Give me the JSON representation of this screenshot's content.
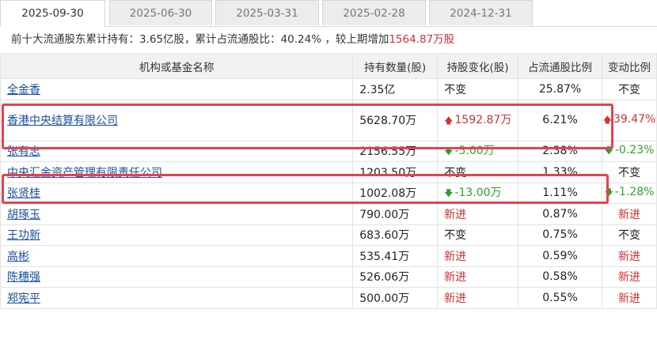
{
  "tabs": [
    {
      "label": "2025-09-30",
      "active": true
    },
    {
      "label": "2025-06-30",
      "active": false
    },
    {
      "label": "2025-03-31",
      "active": false
    },
    {
      "label": "2025-02-28",
      "active": false
    },
    {
      "label": "2024-12-31",
      "active": false
    }
  ],
  "summary": {
    "prefix": "前十大流通股东累计持有：3.65亿股，累计占流通股比：40.24% ，较上期增加",
    "change": "1564.87万股"
  },
  "table": {
    "headers": [
      "机构或基金名称",
      "持有数量(股)",
      "持股变化(股)",
      "占流通股比例",
      "变动比例"
    ],
    "rows": [
      {
        "name": "全金香",
        "qty": "2.35亿",
        "change": "不变",
        "change_dir": "none",
        "ratio": "25.87%",
        "pct": "不变",
        "pct_dir": "none"
      },
      {
        "name": "香港中央结算有限公司",
        "qty": "5628.70万",
        "change": "1592.87万",
        "change_dir": "up",
        "ratio": "6.21%",
        "pct": "39.47%",
        "pct_dir": "up"
      },
      {
        "name": "张有志",
        "qty": "2156.55万",
        "change": "-5.00万",
        "change_dir": "down",
        "ratio": "2.38%",
        "pct": "-0.23%",
        "pct_dir": "down"
      },
      {
        "name": "中央汇金资产管理有限责任公司",
        "qty": "1203.50万",
        "change": "不变",
        "change_dir": "none",
        "ratio": "1.33%",
        "pct": "不变",
        "pct_dir": "none"
      },
      {
        "name": "张贤桂",
        "qty": "1002.08万",
        "change": "-13.00万",
        "change_dir": "down",
        "ratio": "1.11%",
        "pct": "-1.28%",
        "pct_dir": "down"
      },
      {
        "name": "胡琢玉",
        "qty": "790.00万",
        "change": "新进",
        "change_dir": "new",
        "ratio": "0.87%",
        "pct": "新进",
        "pct_dir": "new"
      },
      {
        "name": "王功新",
        "qty": "683.60万",
        "change": "不变",
        "change_dir": "none",
        "ratio": "0.75%",
        "pct": "不变",
        "pct_dir": "none"
      },
      {
        "name": "高彬",
        "qty": "535.41万",
        "change": "新进",
        "change_dir": "new",
        "ratio": "0.59%",
        "pct": "新进",
        "pct_dir": "new"
      },
      {
        "name": "陈穗强",
        "qty": "526.06万",
        "change": "新进",
        "change_dir": "new",
        "ratio": "0.58%",
        "pct": "新进",
        "pct_dir": "new"
      },
      {
        "name": "郑宪平",
        "qty": "500.00万",
        "change": "新进",
        "change_dir": "new",
        "ratio": "0.55%",
        "pct": "新进",
        "pct_dir": "new"
      }
    ]
  },
  "colors": {
    "up": "#d23030",
    "down": "#2fa12f",
    "link": "#1a4fa0",
    "highlight_box": "#e8414b"
  }
}
